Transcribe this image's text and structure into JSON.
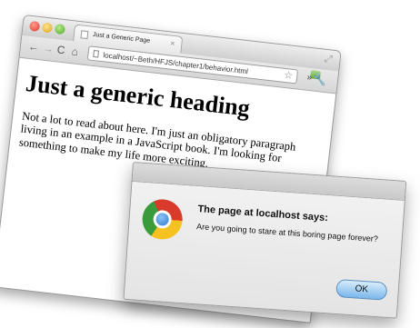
{
  "browser": {
    "tab_title": "Just a Generic Page",
    "tab_close": "×",
    "url": "localhost/~Beth/HFJS/chapter1/behavior.html",
    "nav_icons": {
      "back": "←",
      "forward": "→",
      "reload": "C",
      "home": "⌂"
    },
    "toolbar_icons": {
      "star": "☆",
      "chevron": "»",
      "wrench": "🔧",
      "resize": "⤢"
    }
  },
  "page": {
    "heading": "Just a generic heading",
    "paragraph": "Not a lot to read about here. I'm just an obligatory paragraph living in an example in a JavaScript book. I'm looking for something to make my life more exciting."
  },
  "dialog": {
    "title": "The page at localhost says:",
    "message": "Are you going to stare at this boring page forever?",
    "ok_label": "OK"
  }
}
